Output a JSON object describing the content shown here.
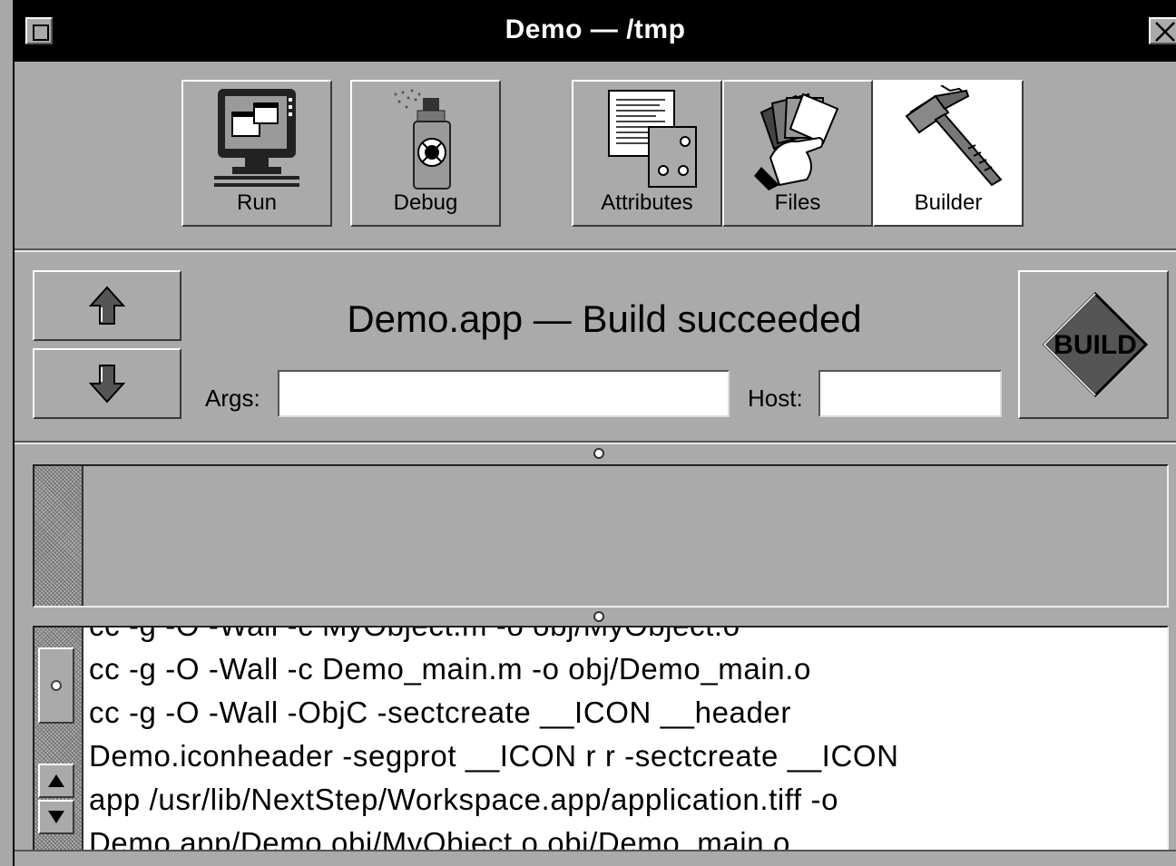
{
  "window": {
    "title": "Demo — /tmp"
  },
  "toolbar": {
    "tools": [
      {
        "label": "Run",
        "icon": "monitor-icon",
        "selected": false
      },
      {
        "label": "Debug",
        "icon": "bug-spray-icon",
        "selected": false
      },
      {
        "label": "Attributes",
        "icon": "document-attributes-icon",
        "selected": false
      },
      {
        "label": "Files",
        "icon": "file-cards-icon",
        "selected": false
      },
      {
        "label": "Builder",
        "icon": "hammer-icon",
        "selected": true
      }
    ]
  },
  "status": {
    "message": "Demo.app — Build succeeded",
    "args_label": "Args:",
    "args_value": "",
    "host_label": "Host:",
    "host_value": "",
    "build_label": "BUILD"
  },
  "log": {
    "lines": [
      "cc -g -O -Wall   -c MyObject.m -o obj/MyObject.o",
      "cc -g -O -Wall   -c Demo_main.m -o obj/Demo_main.o",
      "cc -g -O -Wall  -ObjC  -sectcreate __ICON __header",
      "Demo.iconheader   -segprot __ICON r r -sectcreate __ICON",
      "app /usr/lib/NextStep/Workspace.app/application.tiff  -o",
      "Demo.app/Demo   obj/MyObject.o  obj/Demo_main.o"
    ]
  },
  "colors": {
    "background": "#aaaaaa",
    "titlebar": "#000000",
    "build_diamond": "#555555"
  }
}
